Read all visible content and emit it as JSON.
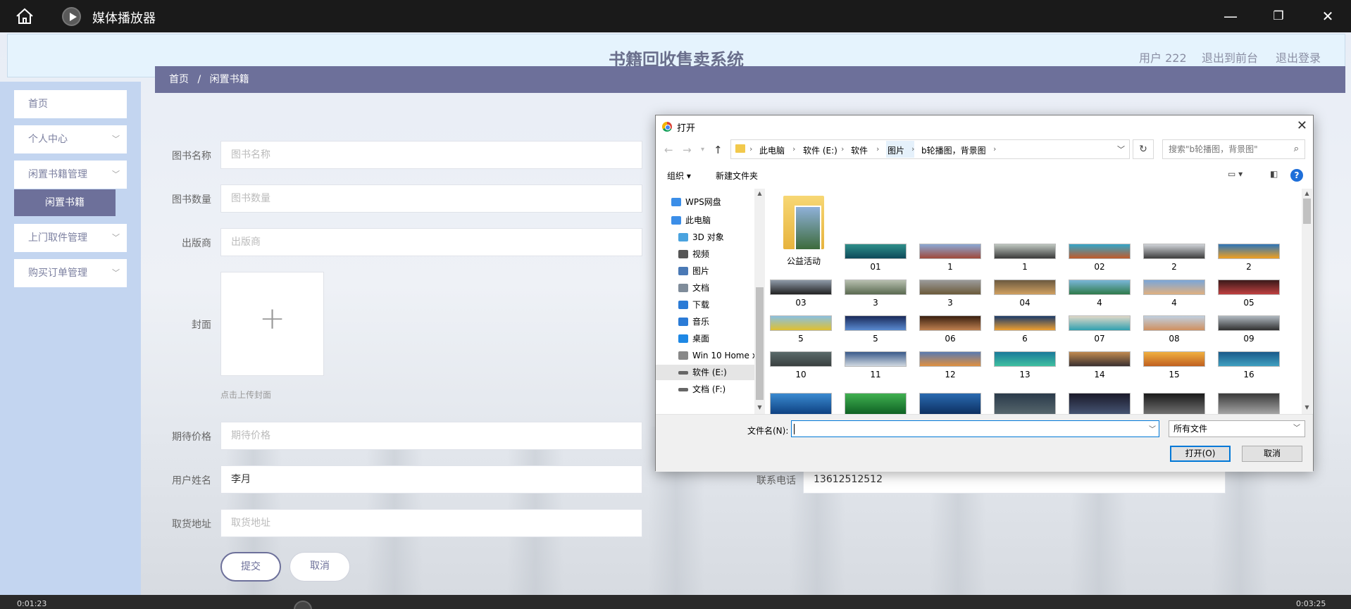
{
  "player": {
    "title": "媒体播放器",
    "minimize": "—",
    "maximize": "❐",
    "close": "✕",
    "time_left": "0:01:23",
    "time_right": "0:03:25"
  },
  "header": {
    "title": "书籍回收售卖系统",
    "user": "用户 222",
    "front": "退出到前台",
    "logout": "退出登录"
  },
  "sidebar": {
    "items": [
      {
        "label": "首页"
      },
      {
        "label": "个人中心"
      },
      {
        "label": "闲置书籍管理"
      },
      {
        "label": "闲置书籍"
      },
      {
        "label": "上门取件管理"
      },
      {
        "label": "购买订单管理"
      }
    ]
  },
  "breadcrumb": {
    "home": "首页",
    "sep": "/",
    "current": "闲置书籍"
  },
  "form": {
    "book_name": {
      "label": "图书名称",
      "placeholder": "图书名称"
    },
    "book_count": {
      "label": "图书数量",
      "placeholder": "图书数量"
    },
    "publisher": {
      "label": "出版商",
      "placeholder": "出版商"
    },
    "cover": {
      "label": "封面",
      "plus": "+",
      "hint": "点击上传封面"
    },
    "price": {
      "label": "期待价格",
      "placeholder": "期待价格"
    },
    "user_name": {
      "label": "用户姓名",
      "value": "李月"
    },
    "phone": {
      "label": "联系电话",
      "value": "13612512512"
    },
    "address": {
      "label": "取货地址",
      "placeholder": "取货地址"
    },
    "submit": "提交",
    "cancel": "取消"
  },
  "dialog": {
    "title": "打开",
    "close": "✕",
    "path": [
      "此电脑",
      "软件 (E:)",
      "软件",
      "图片",
      "b轮播图，背景图"
    ],
    "refresh": "↻",
    "search_placeholder": "搜索\"b轮播图，背景图\"",
    "organize": "组织 ▾",
    "new_folder": "新建文件夹",
    "help": "?",
    "tree": [
      {
        "label": "WPS网盘",
        "color": "#3b8ee8"
      },
      {
        "label": "此电脑",
        "color": "#3b8ee8"
      },
      {
        "label": "3D 对象",
        "color": "#4aa3df"
      },
      {
        "label": "视频",
        "color": "#555"
      },
      {
        "label": "图片",
        "color": "#4a79b5"
      },
      {
        "label": "文档",
        "color": "#7f8c9a"
      },
      {
        "label": "下载",
        "color": "#2b7bd6"
      },
      {
        "label": "音乐",
        "color": "#2b7bd6"
      },
      {
        "label": "桌面",
        "color": "#1e88e5"
      },
      {
        "label": "Win 10 Home x",
        "color": "#888"
      },
      {
        "label": "软件 (E:)",
        "color": "#666"
      },
      {
        "label": "文档 (F:)",
        "color": "#666"
      }
    ],
    "folder_name": "公益活动",
    "files": [
      {
        "name": "01",
        "c1": "#2e8f8a",
        "c2": "#0e4a5a"
      },
      {
        "name": "1",
        "c1": "#8aa9d6",
        "c2": "#a0493a"
      },
      {
        "name": "1",
        "c1": "#bfc7c0",
        "c2": "#3a3a3a"
      },
      {
        "name": "02",
        "c1": "#33a6c9",
        "c2": "#c05a2a"
      },
      {
        "name": "2",
        "c1": "#d0d3d8",
        "c2": "#3d3d3d"
      },
      {
        "name": "2",
        "c1": "#2c74b8",
        "c2": "#f0a020"
      },
      {
        "name": "03",
        "c1": "#8f9aa8",
        "c2": "#222"
      },
      {
        "name": "3",
        "c1": "#b8c0b0",
        "c2": "#5a6a50"
      },
      {
        "name": "3",
        "c1": "#9b9b9b",
        "c2": "#6b5a3a"
      },
      {
        "name": "04",
        "c1": "#6b5a40",
        "c2": "#d0a060"
      },
      {
        "name": "4",
        "c1": "#7ab6d9",
        "c2": "#2e7a4a"
      },
      {
        "name": "4",
        "c1": "#7aa6d9",
        "c2": "#e0b080"
      },
      {
        "name": "05",
        "c1": "#3a1a1a",
        "c2": "#c04040"
      },
      {
        "name": "5",
        "c1": "#8ac0e0",
        "c2": "#e0c030"
      },
      {
        "name": "5",
        "c1": "#1a2a5a",
        "c2": "#5a8ad0"
      },
      {
        "name": "06",
        "c1": "#3a2010",
        "c2": "#c08050"
      },
      {
        "name": "6",
        "c1": "#1a3a6a",
        "c2": "#f0a030"
      },
      {
        "name": "07",
        "c1": "#e0d8c8",
        "c2": "#30a0b0"
      },
      {
        "name": "08",
        "c1": "#c0d0e0",
        "c2": "#d09060"
      },
      {
        "name": "09",
        "c1": "#b0b8c0",
        "c2": "#303030"
      },
      {
        "name": "10",
        "c1": "#5a6a6a",
        "c2": "#3a4040"
      },
      {
        "name": "11",
        "c1": "#3a5a8a",
        "c2": "#d0d8e0"
      },
      {
        "name": "12",
        "c1": "#5a7ab0",
        "c2": "#e09040"
      },
      {
        "name": "13",
        "c1": "#1a7a9a",
        "c2": "#40c0a0"
      },
      {
        "name": "14",
        "c1": "#c08a50",
        "c2": "#3a3030"
      },
      {
        "name": "15",
        "c1": "#f0b040",
        "c2": "#c06020"
      },
      {
        "name": "16",
        "c1": "#1a5a8a",
        "c2": "#40a0c0"
      },
      {
        "name": "",
        "c1": "#3a8ad0",
        "c2": "#0a3a7a"
      },
      {
        "name": "",
        "c1": "#40b050",
        "c2": "#0a5a20"
      },
      {
        "name": "",
        "c1": "#2a6ab0",
        "c2": "#0a2a5a"
      },
      {
        "name": "",
        "c1": "#2a3a4a",
        "c2": "#5a6a70"
      },
      {
        "name": "",
        "c1": "#1a1a2a",
        "c2": "#4a5a7a"
      },
      {
        "name": "",
        "c1": "#1a1a1a",
        "c2": "#7a7a7a"
      },
      {
        "name": "",
        "c1": "#3a3a3a",
        "c2": "#b0b0b0"
      }
    ],
    "filename_label": "文件名(N):",
    "filter": "所有文件",
    "open_btn": "打开(O)",
    "cancel_btn": "取消"
  }
}
